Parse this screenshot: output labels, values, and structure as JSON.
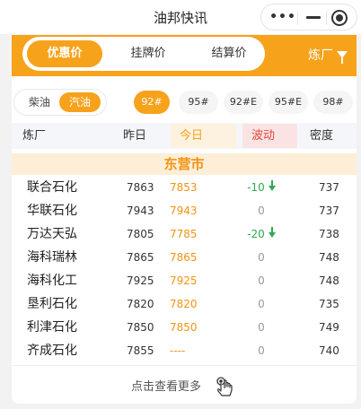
{
  "app": {
    "title": "油邦快讯"
  },
  "capsule": {
    "more": "•••"
  },
  "price_tabs": [
    {
      "label": "优惠价",
      "active": true
    },
    {
      "label": "挂牌价",
      "active": false
    },
    {
      "label": "结算价",
      "active": false
    }
  ],
  "refinery_filter": {
    "label": "炼厂"
  },
  "fuel_types": [
    {
      "label": "柴油",
      "active": false
    },
    {
      "label": "汽油",
      "active": true
    }
  ],
  "grades": [
    {
      "label": "92#",
      "active": true
    },
    {
      "label": "95#",
      "active": false
    },
    {
      "label": "92#E",
      "active": false
    },
    {
      "label": "95#E",
      "active": false
    },
    {
      "label": "98#",
      "active": false
    }
  ],
  "columns": {
    "refinery": "炼厂",
    "yesterday": "昨日",
    "today": "今日",
    "change": "波动",
    "density": "密度"
  },
  "region": "东营市",
  "rows": [
    {
      "name": "联合石化",
      "yesterday": "7863",
      "today": "7853",
      "change": "-10",
      "direction": "down",
      "density": "737"
    },
    {
      "name": "华联石化",
      "yesterday": "7943",
      "today": "7943",
      "change": "0",
      "direction": "flat",
      "density": "737"
    },
    {
      "name": "万达天弘",
      "yesterday": "7805",
      "today": "7785",
      "change": "-20",
      "direction": "down",
      "density": "738"
    },
    {
      "name": "海科瑞林",
      "yesterday": "7865",
      "today": "7865",
      "change": "0",
      "direction": "flat",
      "density": "748"
    },
    {
      "name": "海科化工",
      "yesterday": "7925",
      "today": "7925",
      "change": "0",
      "direction": "flat",
      "density": "748"
    },
    {
      "name": "垦利石化",
      "yesterday": "7820",
      "today": "7820",
      "change": "0",
      "direction": "flat",
      "density": "735"
    },
    {
      "name": "利津石化",
      "yesterday": "7850",
      "today": "7850",
      "change": "0",
      "direction": "flat",
      "density": "749"
    },
    {
      "name": "齐成石化",
      "yesterday": "7855",
      "today": "----",
      "change": "0",
      "direction": "flat",
      "density": "740"
    }
  ],
  "load_more": {
    "label": "点击查看更多"
  },
  "colors": {
    "accent": "#f7a21b",
    "down": "#2daa4f",
    "up": "#e2483e"
  }
}
